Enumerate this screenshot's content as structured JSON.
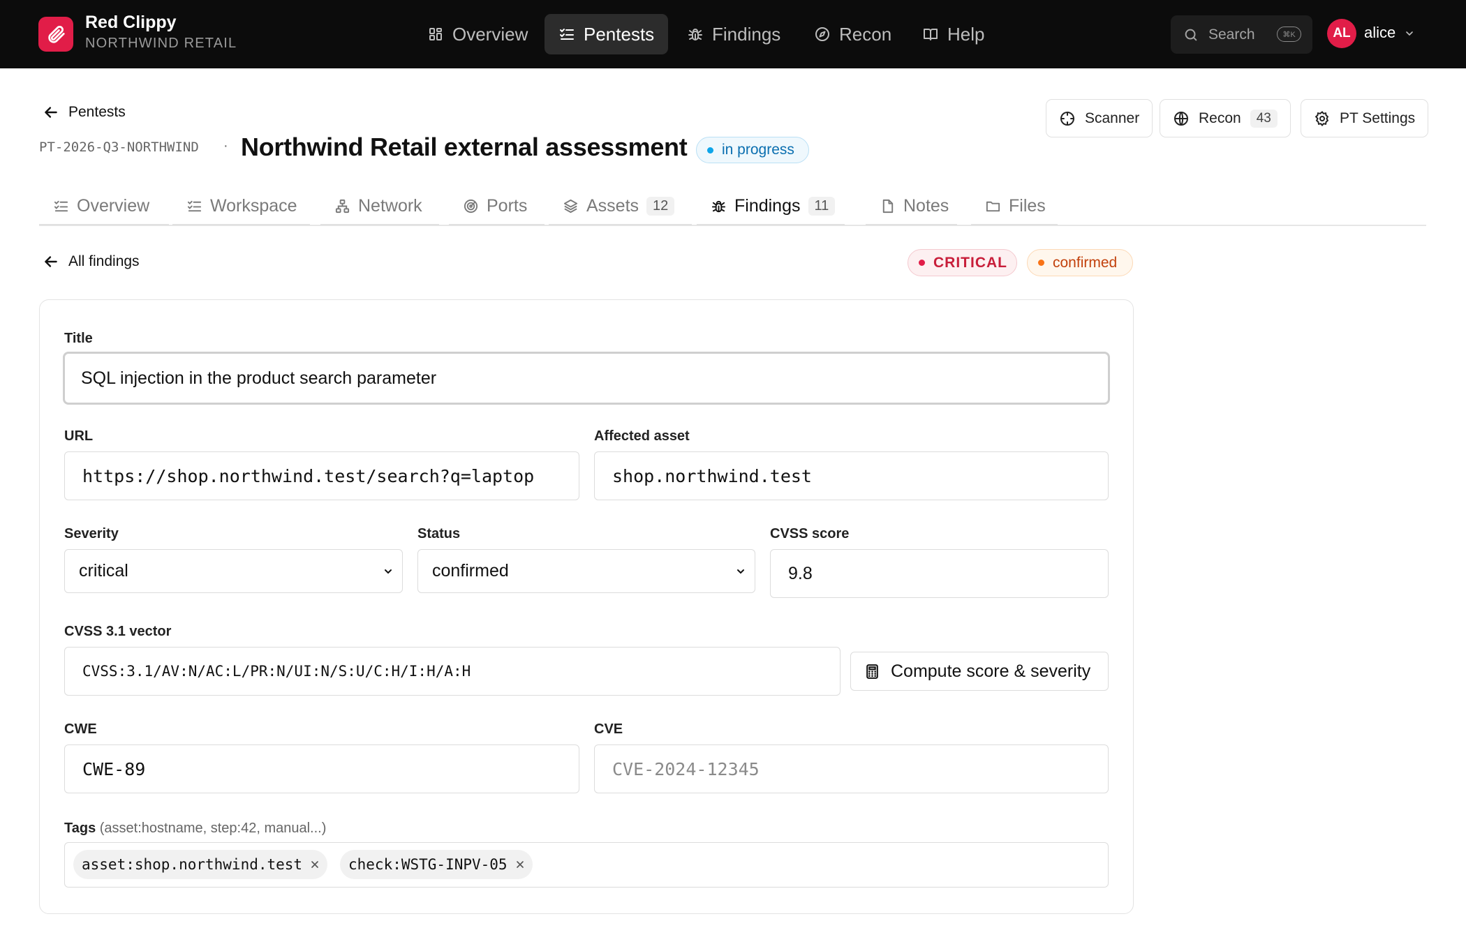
{
  "brand": {
    "name": "Red Clippy",
    "org": "NORTHWIND RETAIL",
    "logo_icon": "paperclip-icon",
    "accent": "#e11d48"
  },
  "nav": {
    "items": [
      {
        "label": "Overview",
        "icon": "grid-icon",
        "active": false
      },
      {
        "label": "Pentests",
        "icon": "checklist-icon",
        "active": true
      },
      {
        "label": "Findings",
        "icon": "bug-icon",
        "active": false
      },
      {
        "label": "Recon",
        "icon": "compass-icon",
        "active": false
      },
      {
        "label": "Help",
        "icon": "book-icon",
        "active": false
      }
    ],
    "search_label": "Search",
    "search_shortcut": "⌘K"
  },
  "user": {
    "initials": "AL",
    "name": "alice"
  },
  "header": {
    "back_label": "Pentests",
    "code": "PT-2026-Q3-NORTHWIND",
    "separator": "·",
    "title": "Northwind Retail external assessment",
    "status": "in progress",
    "buttons": [
      {
        "label": "Scanner",
        "icon": "crosshair-icon"
      },
      {
        "label": "Recon",
        "icon": "globe-icon",
        "count": "43"
      },
      {
        "label": "PT Settings",
        "icon": "gear-icon"
      }
    ]
  },
  "tabs": [
    {
      "label": "Overview",
      "icon": "checklist-icon"
    },
    {
      "label": "Workspace",
      "icon": "checklist-icon"
    },
    {
      "label": "Network",
      "icon": "network-icon"
    },
    {
      "label": "Ports",
      "icon": "radar-icon"
    },
    {
      "label": "Assets",
      "icon": "layers-icon",
      "count": "12"
    },
    {
      "label": "Findings",
      "icon": "bug-icon",
      "count": "11",
      "active": true
    },
    {
      "label": "Notes",
      "icon": "file-icon"
    },
    {
      "label": "Files",
      "icon": "folder-icon"
    }
  ],
  "finding": {
    "back_label": "All findings",
    "severity_badge": "CRITICAL",
    "status_badge": "confirmed",
    "fields": {
      "title_label": "Title",
      "title_value": "SQL injection in the product search parameter",
      "url_label": "URL",
      "url_value": "https://shop.northwind.test/search?q=laptop",
      "asset_label": "Affected asset",
      "asset_value": "shop.northwind.test",
      "severity_label": "Severity",
      "severity_value": "critical",
      "status_label": "Status",
      "status_value": "confirmed",
      "cvss_score_label": "CVSS score",
      "cvss_score_value": "9.8",
      "cvss_vector_label": "CVSS 3.1 vector",
      "cvss_vector_value": "CVSS:3.1/AV:N/AC:L/PR:N/UI:N/S:U/C:H/I:H/A:H",
      "compute_label": "Compute score & severity",
      "cwe_label": "CWE",
      "cwe_value": "CWE-89",
      "cve_label": "CVE",
      "cve_placeholder": "CVE-2024-12345",
      "tags_label": "Tags",
      "tags_hint": "(asset:hostname, step:42, manual...)",
      "tags": [
        "asset:shop.northwind.test",
        "check:WSTG-INPV-05"
      ]
    }
  }
}
